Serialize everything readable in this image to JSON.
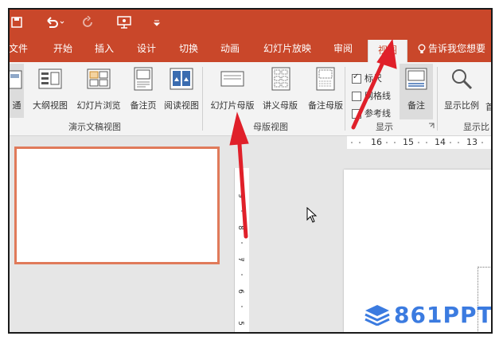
{
  "tabs": [
    {
      "label": "文件"
    },
    {
      "label": "开始"
    },
    {
      "label": "插入"
    },
    {
      "label": "设计"
    },
    {
      "label": "切换"
    },
    {
      "label": "动画"
    },
    {
      "label": "幻灯片放映"
    },
    {
      "label": "审阅"
    },
    {
      "label": "视图",
      "active": true
    }
  ],
  "tell_me": "告诉我您想要",
  "ribbon": {
    "presentation_views": {
      "label": "演示文稿视图",
      "buttons": [
        "通",
        "大纲视图",
        "幻灯片浏览",
        "备注页",
        "阅读视图"
      ]
    },
    "master_views": {
      "label": "母版视图",
      "buttons": [
        "幻灯片母版",
        "讲义母版",
        "备注母版"
      ]
    },
    "show": {
      "label": "显示",
      "checkboxes": [
        {
          "label": "标尺",
          "checked": true
        },
        {
          "label": "网格线",
          "checked": false
        },
        {
          "label": "参考线",
          "checked": false
        }
      ],
      "notes_button": "备注"
    },
    "zoom": {
      "label": "显示比",
      "button": "显示比例",
      "extra": "首"
    }
  },
  "ruler": {
    "horizontal": [
      "16",
      "15",
      "14",
      "13"
    ],
    "vertical": [
      "9",
      "8",
      "7",
      "6",
      "5"
    ]
  },
  "watermark": "861PPT",
  "colors": {
    "accent": "#c9472a",
    "arrow": "#e0202a",
    "watermark": "#3b7be0"
  }
}
